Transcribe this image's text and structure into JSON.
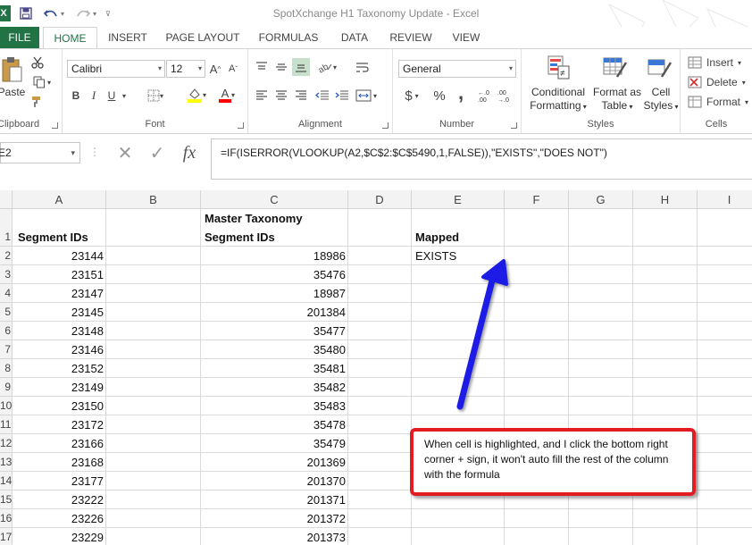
{
  "window": {
    "title": "SpotXchange H1 Taxonomy Update - Excel",
    "app_icon": "X"
  },
  "quick_access": {
    "save_icon": "save-icon",
    "undo_icon": "undo-icon",
    "redo_icon": "redo-icon",
    "customize_icon": "customize-qat-icon"
  },
  "tabs": [
    {
      "label": "FILE"
    },
    {
      "label": "HOME"
    },
    {
      "label": "INSERT"
    },
    {
      "label": "PAGE LAYOUT"
    },
    {
      "label": "FORMULAS"
    },
    {
      "label": "DATA"
    },
    {
      "label": "REVIEW"
    },
    {
      "label": "VIEW"
    }
  ],
  "ribbon": {
    "clipboard": {
      "label": "Clipboard",
      "paste": "Paste"
    },
    "font": {
      "label": "Font",
      "name": "Calibri",
      "size": "12",
      "grow": "A",
      "shrink": "A",
      "bold": "B",
      "italic": "I",
      "underline": "U",
      "font_color_glyph": "A",
      "fill_color": "#FFFF00",
      "text_color": "#FF0000"
    },
    "alignment": {
      "label": "Alignment"
    },
    "number": {
      "label": "Number",
      "format": "General",
      "currency": "$",
      "percent": "%",
      "comma": ","
    },
    "styles": {
      "label": "Styles",
      "conditional": "Conditional",
      "conditional2": "Formatting",
      "format_table": "Format as",
      "format_table2": "Table",
      "cell_styles": "Cell",
      "cell_styles2": "Styles"
    },
    "cells": {
      "label": "Cells",
      "insert": "Insert",
      "delete": "Delete",
      "format": "Format"
    }
  },
  "formula_bar": {
    "name_box": "E2",
    "cancel": "✕",
    "enter": "✓",
    "fx": "fx",
    "formula": "=IF(ISERROR(VLOOKUP(A2,$C$2:$C$5490,1,FALSE)),\"EXISTS\",\"DOES NOT\")"
  },
  "grid": {
    "columns": [
      "A",
      "B",
      "C",
      "D",
      "E",
      "F",
      "G",
      "H",
      "I"
    ],
    "rows": [
      "1",
      "2",
      "3",
      "4",
      "5",
      "6",
      "7",
      "8",
      "9",
      "10",
      "11",
      "12",
      "13",
      "14",
      "15",
      "16",
      "17"
    ],
    "headers": {
      "a1": "Segment IDs",
      "c1_line1": "Master Taxonomy",
      "c1_line2": "Segment IDs",
      "e1": "Mapped"
    },
    "col_a": [
      "23144",
      "23151",
      "23147",
      "23145",
      "23148",
      "23146",
      "23152",
      "23149",
      "23150",
      "23172",
      "23166",
      "23168",
      "23177",
      "23222",
      "23226",
      "23229"
    ],
    "col_c": [
      "18986",
      "35476",
      "18987",
      "201384",
      "35477",
      "35480",
      "35481",
      "35482",
      "35483",
      "35478",
      "35479",
      "201369",
      "201370",
      "201371",
      "201372",
      "201373"
    ],
    "e2": "EXISTS"
  },
  "annotation": {
    "text": "When cell is highlighted, and I click the bottom right corner + sign, it won't auto fill the rest of the column with the formula",
    "border_color": "#E31B23",
    "arrow_color": "#1A1AE6"
  }
}
